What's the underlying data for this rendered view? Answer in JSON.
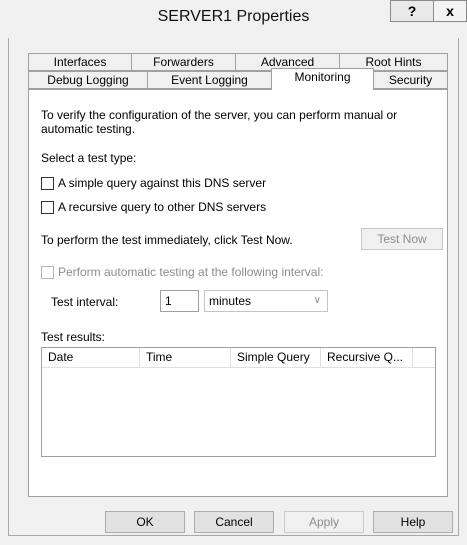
{
  "window": {
    "title": "SERVER1 Properties",
    "help_label": "?",
    "close_label": "x"
  },
  "tabs": {
    "row1": [
      "Interfaces",
      "Forwarders",
      "Advanced",
      "Root Hints"
    ],
    "row2": [
      "Debug Logging",
      "Event Logging",
      "Monitoring",
      "Security"
    ],
    "active": "Monitoring"
  },
  "monitoring": {
    "intro_line1": "To verify the configuration of the server, you can perform manual or",
    "intro_line2": "automatic testing.",
    "select_label": "Select a test type:",
    "simple_query_label": "A simple query against this DNS server",
    "recursive_query_label": "A recursive query to other DNS servers",
    "perform_now_text": "To perform the test immediately, click Test Now.",
    "test_now_label": "Test Now",
    "auto_test_label": "Perform automatic testing at the following interval:",
    "interval_label": "Test interval:",
    "interval_value": "1",
    "interval_unit": "minutes",
    "results_label": "Test results:",
    "columns": [
      "Date",
      "Time",
      "Simple Query",
      "Recursive Q..."
    ]
  },
  "footer": {
    "ok": "OK",
    "cancel": "Cancel",
    "apply": "Apply",
    "help": "Help"
  }
}
